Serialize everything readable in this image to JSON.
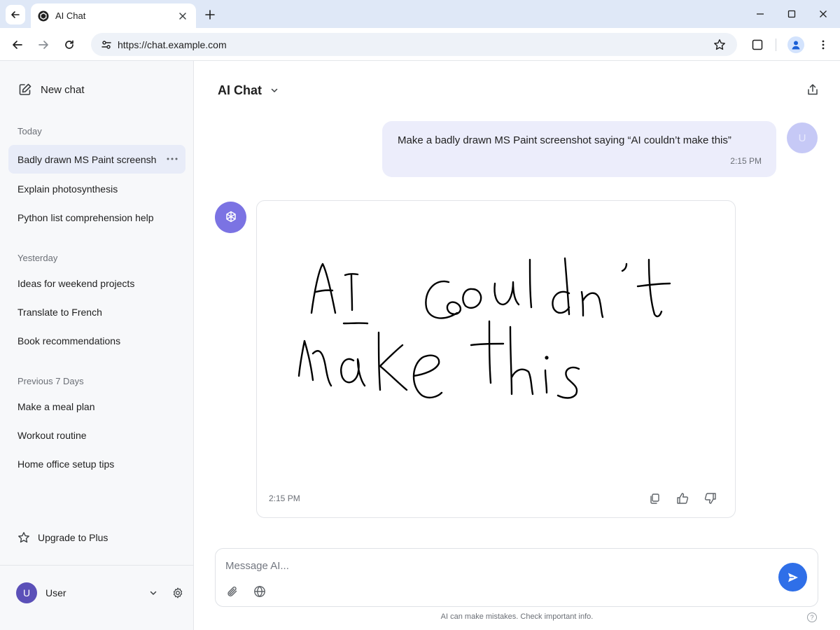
{
  "browser": {
    "tab_title": "AI Chat",
    "url": "https://chat.example.com"
  },
  "sidebar": {
    "new_chat_label": "New chat",
    "sections": [
      {
        "label": "Today",
        "items": [
          {
            "label": "Badly drawn MS Paint screenshot",
            "active": true
          },
          {
            "label": "Explain photosynthesis"
          },
          {
            "label": "Python list comprehension help"
          }
        ]
      },
      {
        "label": "Yesterday",
        "items": [
          {
            "label": "Ideas for weekend projects"
          },
          {
            "label": "Translate to French"
          },
          {
            "label": "Book recommendations"
          }
        ]
      },
      {
        "label": "Previous 7 Days",
        "items": [
          {
            "label": "Make a meal plan"
          },
          {
            "label": "Workout routine"
          },
          {
            "label": "Home office setup tips"
          }
        ]
      }
    ],
    "upgrade_label": "Upgrade to Plus",
    "user": {
      "initial": "U",
      "name": "User"
    }
  },
  "main": {
    "model_title": "AI Chat",
    "user_message": {
      "text": "Make a badly drawn MS Paint screenshot saying “AI couldn’t make this”",
      "time": "2:15 PM",
      "avatar_initial": "U"
    },
    "ai_message": {
      "image_text_line1": "AI couldn’t",
      "image_text_line2": "make this",
      "time": "2:15 PM"
    },
    "composer": {
      "placeholder": "Message AI..."
    },
    "disclaimer": "AI can make mistakes. Check important info.",
    "help_glyph": "?"
  },
  "colors": {
    "accent": "#2f6fe8",
    "ai_avatar": "#7b73e3",
    "user_bubble": "#ecedfb",
    "active_item": "#e8ecf8"
  }
}
